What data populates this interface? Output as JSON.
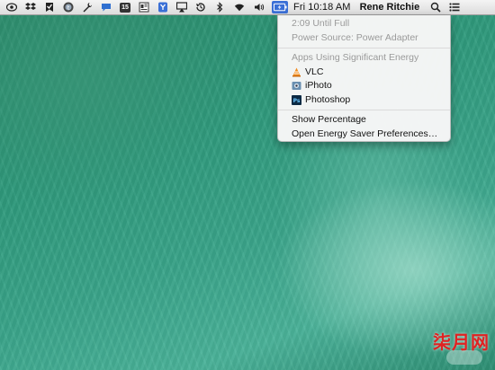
{
  "menubar": {
    "clock": "Fri 10:18 AM",
    "user": "Rene Ritchie",
    "icons": [
      "eye-icon",
      "dropbox-icon",
      "checkmark-icon",
      "tweetbot-icon",
      "wrench-icon",
      "speech-bubble-icon",
      "calendar-icon",
      "pdf-icon",
      "app-icon",
      "airplay-icon",
      "time-machine-icon",
      "bluetooth-icon",
      "wifi-icon",
      "volume-icon",
      "battery-icon",
      "spotlight-icon",
      "notification-center-icon"
    ],
    "calendar_day": "15"
  },
  "battery_menu": {
    "time_remaining": "2:09 Until Full",
    "power_source": "Power Source: Power Adapter",
    "apps_header": "Apps Using Significant Energy",
    "apps": [
      {
        "name": "VLC",
        "icon": "vlc-icon"
      },
      {
        "name": "iPhoto",
        "icon": "iphoto-icon"
      },
      {
        "name": "Photoshop",
        "icon": "photoshop-icon"
      }
    ],
    "show_percentage": "Show Percentage",
    "energy_prefs": "Open Energy Saver Preferences…"
  },
  "watermark": "柒月网",
  "colors": {
    "accent": "#3a6fd6",
    "desktop": "#2f9a7c"
  }
}
